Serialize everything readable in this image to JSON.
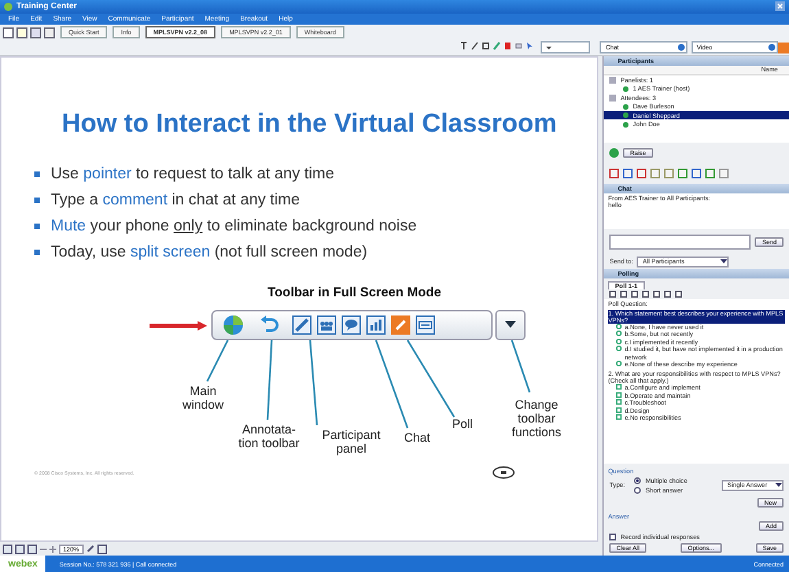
{
  "window": {
    "title": "Training Center"
  },
  "menu": [
    "File",
    "Edit",
    "Share",
    "View",
    "Communicate",
    "Participant",
    "Meeting",
    "Breakout",
    "Help"
  ],
  "doc_tabs": [
    {
      "label": "Quick Start",
      "selected": false
    },
    {
      "label": "Info",
      "selected": false
    },
    {
      "label": "MPLSVPN v2.2_08",
      "selected": true
    },
    {
      "label": "MPLSVPN v2.2_01",
      "selected": false
    },
    {
      "label": "Whiteboard",
      "selected": false
    }
  ],
  "panel_selectors": [
    "Chat",
    "Video"
  ],
  "slide": {
    "title": "How to Interact in the Virtual Classroom",
    "bullets": [
      [
        {
          "text": "Use ",
          "kind": "plain"
        },
        {
          "text": "pointer",
          "kind": "link"
        },
        {
          "text": " to request to talk at any time",
          "kind": "plain"
        }
      ],
      [
        {
          "text": "Type a ",
          "kind": "plain"
        },
        {
          "text": "comment",
          "kind": "link"
        },
        {
          "text": " in chat at any time",
          "kind": "plain"
        }
      ],
      [
        {
          "text": "Mute",
          "kind": "link"
        },
        {
          "text": " your phone ",
          "kind": "plain"
        },
        {
          "text": "only",
          "kind": "underline"
        },
        {
          "text": " to eliminate background noise",
          "kind": "plain"
        }
      ],
      [
        {
          "text": "Today, use ",
          "kind": "plain"
        },
        {
          "text": "split screen",
          "kind": "link"
        },
        {
          "text": " (not full screen mode)",
          "kind": "plain"
        }
      ]
    ],
    "diagram_title": "Toolbar in Full Screen Mode",
    "callouts": [
      "Main window",
      "Annotata-tion toolbar",
      "Participant panel",
      "Chat",
      "Poll",
      "Change toolbar functions"
    ],
    "footer": "© 2008 Cisco Systems, Inc. All rights reserved."
  },
  "zoom": "120%",
  "participants": {
    "title": "Participants",
    "column": "Name",
    "groups": [
      {
        "label": "Panelists: 1",
        "members": [
          {
            "name": "1 AES Trainer (host)",
            "selected": false
          }
        ]
      },
      {
        "label": "Attendees: 3",
        "members": [
          {
            "name": "Dave Burleson",
            "selected": false
          },
          {
            "name": "Daniel Sheppard",
            "selected": true
          },
          {
            "name": "John Doe",
            "selected": false
          }
        ]
      }
    ],
    "raise_button": "Raise"
  },
  "chat": {
    "title": "Chat",
    "messages": [
      "From AES Trainer to All Participants:",
      "hello"
    ],
    "send_button": "Send",
    "send_to_label": "Send to:",
    "send_to": "All Participants"
  },
  "polling": {
    "title": "Polling",
    "tab": "Poll 1-1",
    "question_label": "Poll Question:",
    "questions": [
      {
        "text": "1. Which statement best describes your experience with MPLS VPNs?",
        "selected": true,
        "kind": "radio",
        "options": [
          "a.None, I have never used it",
          "b.Some, but not recently",
          "c.I implemented it recently",
          "d.I studied it, but have not implemented it in a production network",
          "e.None of these describe my experience"
        ]
      },
      {
        "text": "2. What are your responsibilities with respect to MPLS VPNs? (Check all that apply.)",
        "selected": false,
        "kind": "checkbox",
        "options": [
          "a.Configure and implement",
          "b.Operate and maintain",
          "c.Troubleshoot",
          "d.Design",
          "e.No responsibilities"
        ]
      }
    ],
    "question_section": "Question",
    "type_label": "Type:",
    "types": [
      {
        "label": "Multiple choice",
        "selected": true
      },
      {
        "label": "Short answer",
        "selected": false
      }
    ],
    "answer_mode": "Single Answer",
    "new_button": "New",
    "answer_section": "Answer",
    "add_button": "Add",
    "record": {
      "label": "Record individual responses",
      "checked": false
    },
    "buttons": [
      "Clear All",
      "Options...",
      "Save"
    ]
  },
  "status": {
    "logo": "webex",
    "session": "Session No.: 578 321 936 | Call connected",
    "state": "Connected"
  }
}
